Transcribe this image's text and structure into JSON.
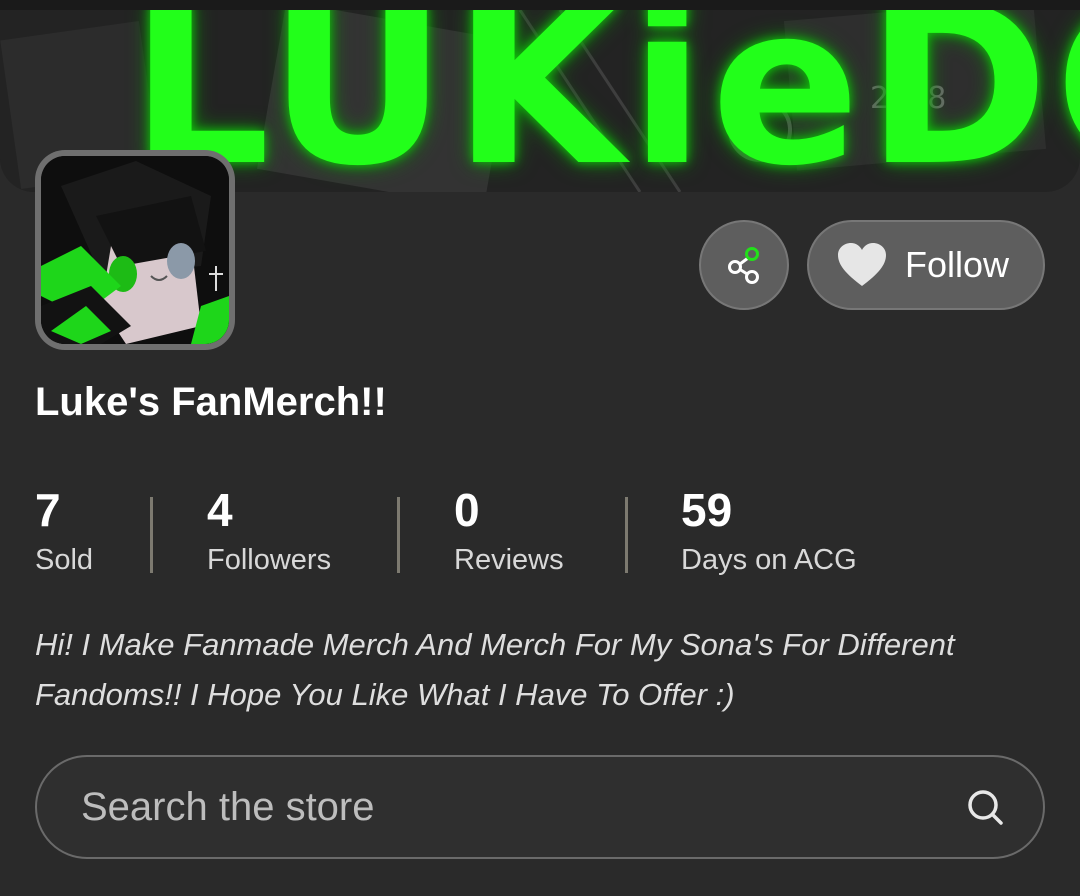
{
  "banner": {
    "logo_text": "LUKieDC"
  },
  "store": {
    "name": "Luke's FanMerch!!",
    "bio": "Hi! I Make Fanmade Merch And Merch For My Sona's For Different Fandoms!! I Hope You Like What I Have To Offer :)"
  },
  "actions": {
    "share_icon": "share-icon",
    "follow_icon": "heart-icon",
    "follow_label": "Follow"
  },
  "stats": [
    {
      "value": "7",
      "label": "Sold"
    },
    {
      "value": "4",
      "label": "Followers"
    },
    {
      "value": "0",
      "label": "Reviews"
    },
    {
      "value": "59",
      "label": "Days on ACG"
    }
  ],
  "search": {
    "placeholder": "Search the store",
    "value": "",
    "icon": "search-icon"
  },
  "colors": {
    "background": "#2a2a2a",
    "accent_green": "#22ff1a",
    "button_bg": "#5e5e5e"
  }
}
